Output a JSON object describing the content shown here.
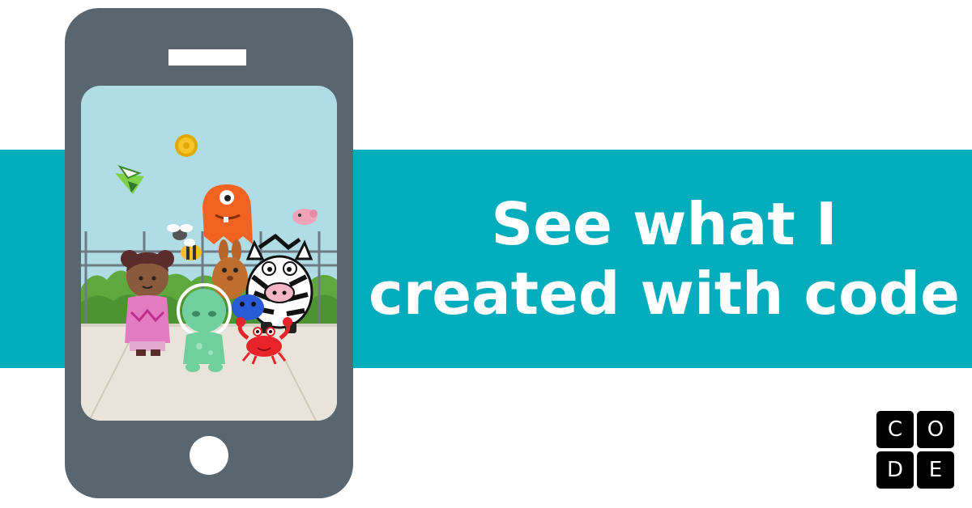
{
  "headline": {
    "line1": "See what I",
    "line2": "created with code"
  },
  "logo": {
    "letters": [
      "C",
      "O",
      "D",
      "E"
    ]
  },
  "colors": {
    "banner": "#00adbc",
    "phone_body": "#596670",
    "sky": "#b0dce6",
    "sidewalk": "#e8e4da",
    "text": "#ffffff"
  },
  "icons": {
    "coin": "coin-icon",
    "paper_plane": "paper-plane-icon",
    "home": "home-button-icon"
  }
}
